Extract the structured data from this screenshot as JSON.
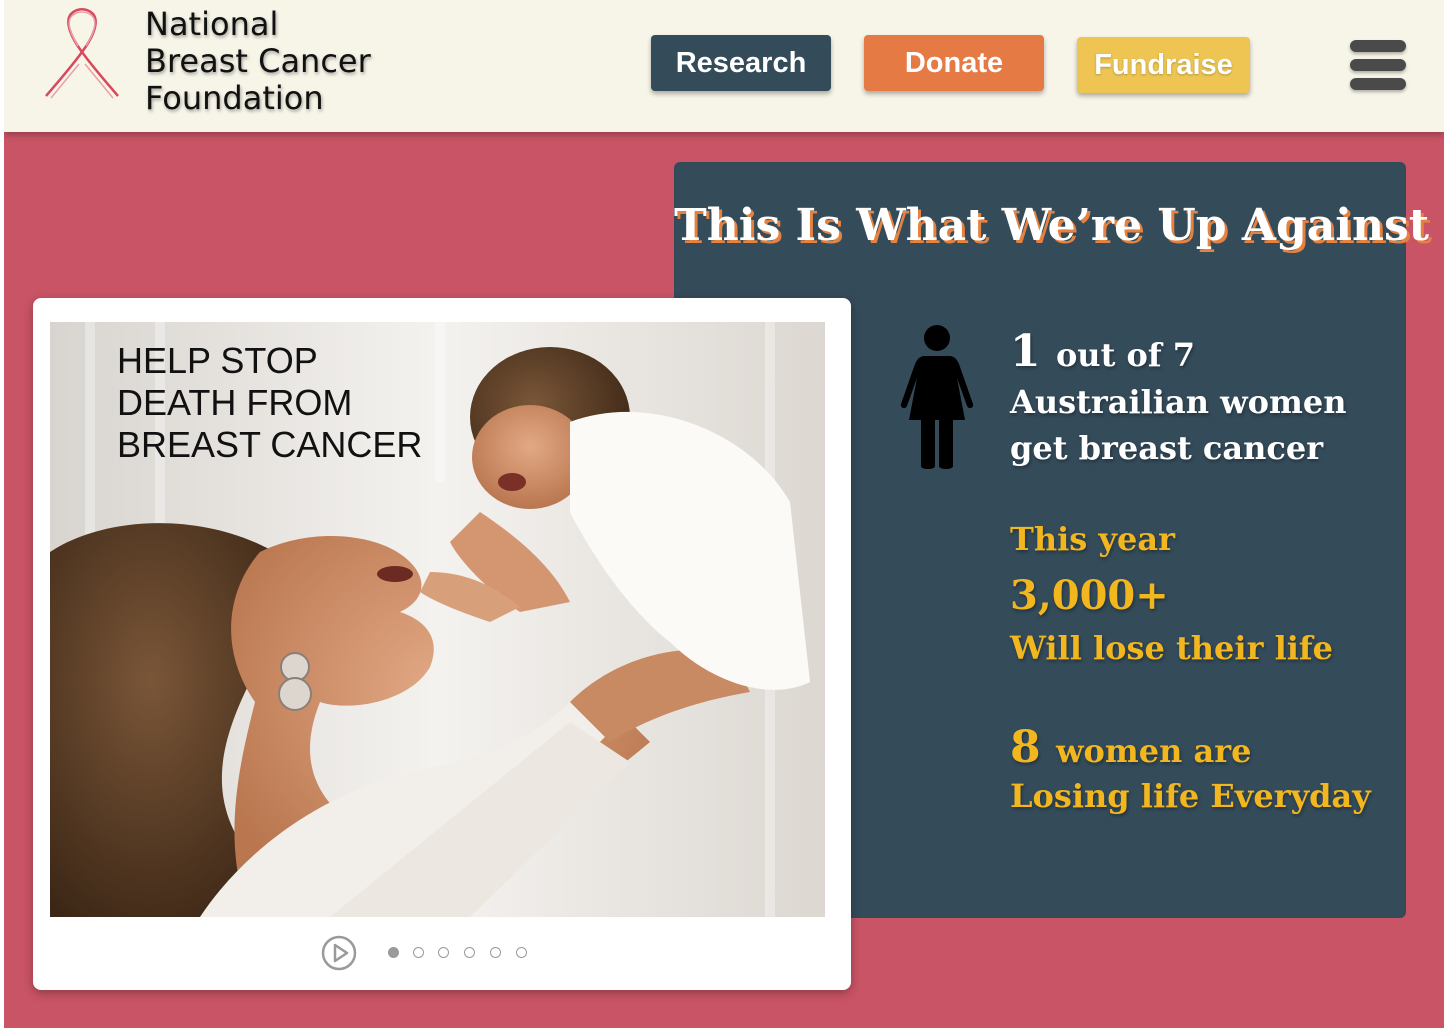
{
  "header": {
    "logo_lines": [
      "National",
      "Breast Cancer",
      "Foundation"
    ],
    "nav": {
      "research": "Research",
      "donate": "Donate",
      "fundraise": "Fundraise"
    },
    "menu_icon": "hamburger-menu-icon"
  },
  "colors": {
    "page_background": "#c95465",
    "header_background": "#f7f5e8",
    "panel_background": "#344b5a",
    "research_button": "#344b5a",
    "donate_button": "#e67a45",
    "fundraise_button": "#eec552",
    "stat_gold": "#f2b71f",
    "ribbon": "#d9495e"
  },
  "slideshow": {
    "caption_lines": [
      "HELP STOP",
      "DEATH FROM",
      "BREAST CANCER"
    ],
    "slide_count": 6,
    "active_slide": 1,
    "play_icon": "play-circle-icon"
  },
  "stats_panel": {
    "title": "This Is What We’re Up Against",
    "person_icon": "woman-silhouette-icon",
    "stat1": {
      "number": "1",
      "rest": "out of 7",
      "line2": "Austrailian women",
      "line3": "get breast cancer"
    },
    "stat2": {
      "line1": "This year",
      "number": "3,000+",
      "line3": "Will lose their life"
    },
    "stat3": {
      "number": "8",
      "rest": "women are",
      "line2": "Losing life Everyday"
    }
  }
}
